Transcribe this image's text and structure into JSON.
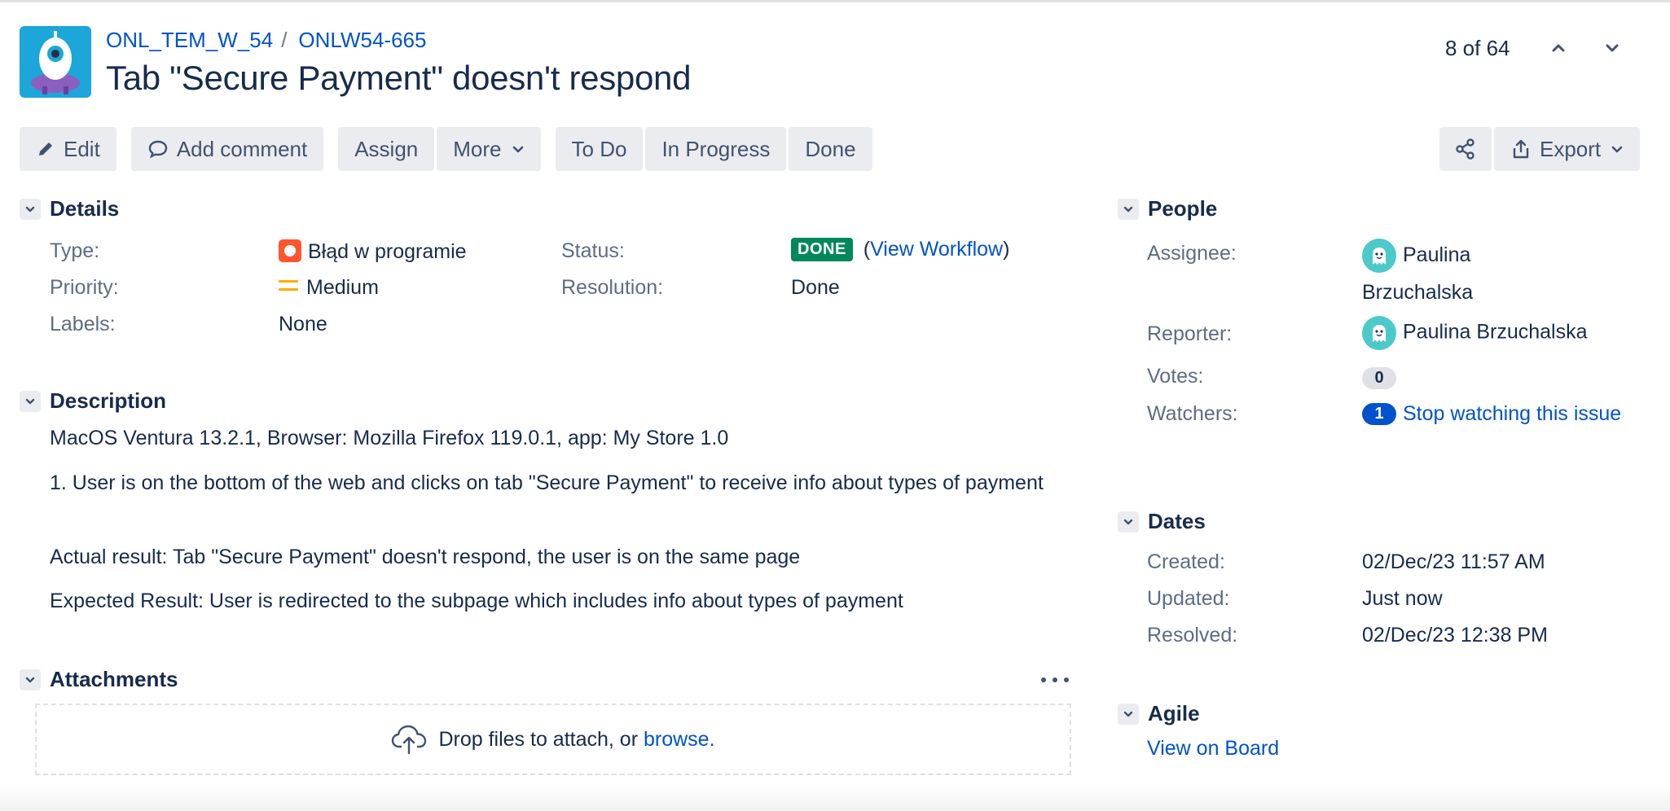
{
  "breadcrumb": {
    "project": "ONL_TEM_W_54",
    "separator": "/",
    "issue_key": "ONLW54-665"
  },
  "issue": {
    "title": "Tab \"Secure Payment\" doesn't respond"
  },
  "pager": {
    "text": "8 of 64"
  },
  "toolbar": {
    "edit": "Edit",
    "add_comment": "Add comment",
    "assign": "Assign",
    "more": "More",
    "to_do": "To Do",
    "in_progress": "In Progress",
    "done": "Done",
    "export": "Export"
  },
  "details": {
    "heading": "Details",
    "type_label": "Type:",
    "type_value": "Błąd w programie",
    "priority_label": "Priority:",
    "priority_value": "Medium",
    "labels_label": "Labels:",
    "labels_value": "None",
    "status_label": "Status:",
    "status_value": "DONE",
    "view_workflow": "View Workflow",
    "resolution_label": "Resolution:",
    "resolution_value": "Done"
  },
  "description": {
    "heading": "Description",
    "lines": [
      "MacOS Ventura 13.2.1, Browser: Mozilla Firefox 119.0.1, app: My Store 1.0",
      "1. User is on the bottom of the web and clicks on tab \"Secure Payment\" to receive info about types of payment",
      "Actual result: Tab \"Secure Payment\" doesn't respond, the user is on the same page",
      "Expected Result: User is redirected to the subpage which includes info about types of payment"
    ]
  },
  "attachments": {
    "heading": "Attachments",
    "drop_text": "Drop files to attach, or ",
    "browse": "browse."
  },
  "people": {
    "heading": "People",
    "assignee_label": "Assignee:",
    "assignee": "Paulina Brzuchalska",
    "reporter_label": "Reporter:",
    "reporter": "Paulina Brzuchalska",
    "votes_label": "Votes:",
    "votes": "0",
    "watchers_label": "Watchers:",
    "watchers": "1",
    "stop_watching": "Stop watching this issue"
  },
  "dates": {
    "heading": "Dates",
    "created_label": "Created:",
    "created": "02/Dec/23 11:57 AM",
    "updated_label": "Updated:",
    "updated": "Just now",
    "resolved_label": "Resolved:",
    "resolved": "02/Dec/23 12:38 PM"
  },
  "agile": {
    "heading": "Agile",
    "view_on_board": "View on Board"
  },
  "colors": {
    "primary_text": "#172b4d",
    "link": "#0052cc",
    "done_green": "#00875a",
    "bug_red": "#ff5630",
    "priority_medium": "#ffab00"
  },
  "icons": [
    "project-avatar-icon",
    "chevron-up-icon",
    "chevron-down-icon",
    "pencil-icon",
    "comment-icon",
    "share-icon",
    "export-icon",
    "bug-icon",
    "priority-medium-icon",
    "user-avatar-icon",
    "upload-cloud-icon",
    "more-icon"
  ]
}
